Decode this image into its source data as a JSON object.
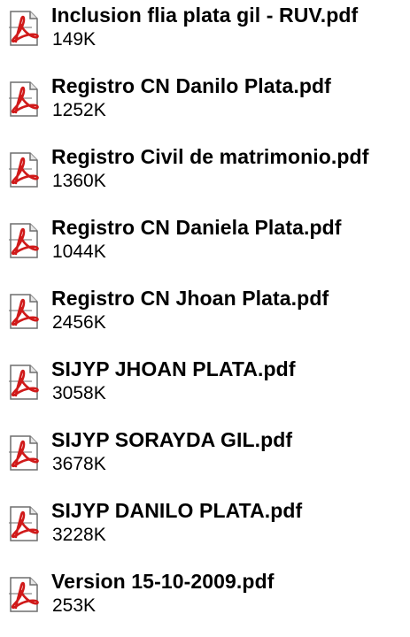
{
  "files": [
    {
      "name": "Inclusion flia plata gil - RUV.pdf",
      "size": "149K",
      "icon": "pdf-file-icon"
    },
    {
      "name": "Registro CN Danilo Plata.pdf",
      "size": "1252K",
      "icon": "pdf-file-icon"
    },
    {
      "name": "Registro Civil de matrimonio.pdf",
      "size": "1360K",
      "icon": "pdf-file-icon"
    },
    {
      "name": "Registro CN Daniela Plata.pdf",
      "size": "1044K",
      "icon": "pdf-file-icon"
    },
    {
      "name": "Registro CN Jhoan Plata.pdf",
      "size": "2456K",
      "icon": "pdf-file-icon"
    },
    {
      "name": "SIJYP JHOAN PLATA.pdf",
      "size": "3058K",
      "icon": "pdf-file-icon"
    },
    {
      "name": "SIJYP SORAYDA GIL.pdf",
      "size": "3678K",
      "icon": "pdf-file-icon"
    },
    {
      "name": "SIJYP DANILO PLATA.pdf",
      "size": "3228K",
      "icon": "pdf-file-icon"
    },
    {
      "name": "Version 15-10-2009.pdf",
      "size": "253K",
      "icon": "pdf-file-icon"
    }
  ],
  "colors": {
    "icon_red": "#d01a1a",
    "icon_page": "#ffffff",
    "icon_border": "#6e6e6e"
  }
}
